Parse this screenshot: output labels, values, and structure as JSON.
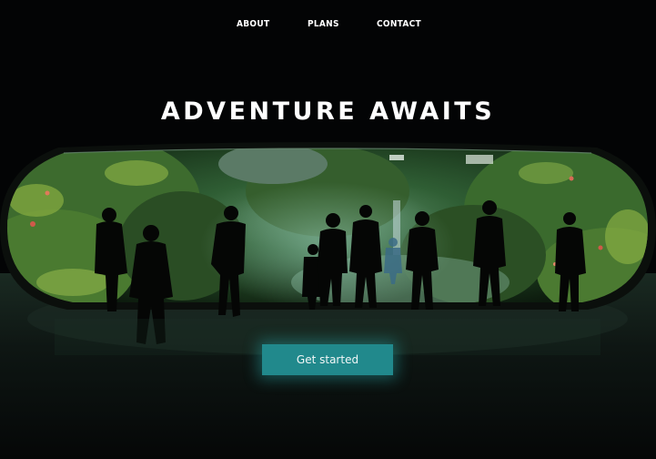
{
  "nav": {
    "about": "ABOUT",
    "plans": "PLANS",
    "contact": "CONTACT"
  },
  "hero": {
    "title": "ADVENTURE AWAITS",
    "image": "aquarium-silhouettes-image"
  },
  "cta": {
    "label": "Get started"
  },
  "colors": {
    "background": "#030405",
    "button": "#21898c",
    "button_text": "#f2f7f7",
    "foliage": "#2e5a2a"
  }
}
